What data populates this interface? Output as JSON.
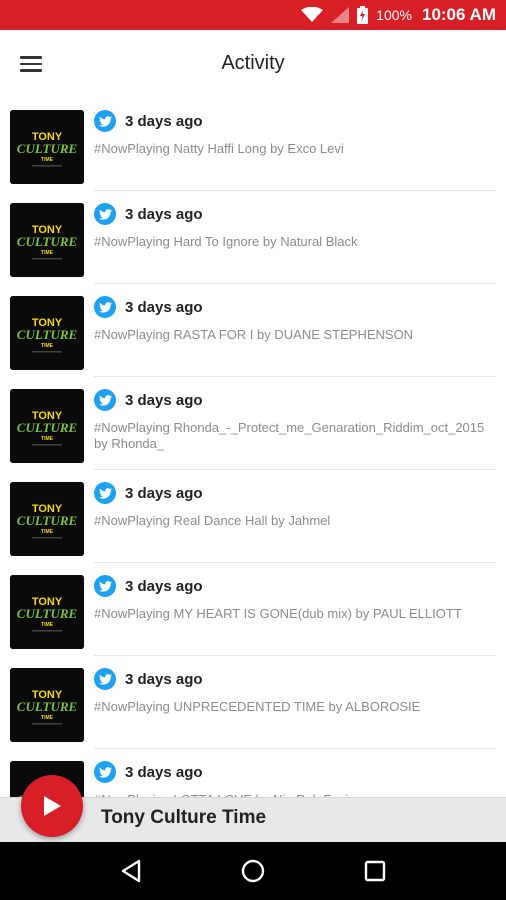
{
  "status_bar": {
    "wifi_icon": "wifi-icon",
    "signal_icon": "signal-icon",
    "battery_icon": "battery-charging-icon",
    "battery": "100%",
    "time": "10:06 AM"
  },
  "app_bar": {
    "menu_icon": "hamburger-menu-icon",
    "title": "Activity"
  },
  "feed": {
    "items": [
      {
        "time": "3 days ago",
        "text": "#NowPlaying Natty Haffi Long by Exco Levi"
      },
      {
        "time": "3 days ago",
        "text": "#NowPlaying Hard To Ignore by Natural Black"
      },
      {
        "time": "3 days ago",
        "text": "#NowPlaying RASTA FOR I by DUANE STEPHENSON"
      },
      {
        "time": "3 days ago",
        "text": "#NowPlaying Rhonda_-_Protect_me_Genaration_Riddim_oct_2015 by Rhonda_"
      },
      {
        "time": "3 days ago",
        "text": "#NowPlaying Real Dance Hall by Jahmel"
      },
      {
        "time": "3 days ago",
        "text": "#NowPlaying MY HEART IS GONE(dub mix) by PAUL ELLIOTT"
      },
      {
        "time": "3 days ago",
        "text": "#NowPlaying UNPRECEDENTED TIME by ALBOROSIE"
      },
      {
        "time": "3 days ago",
        "text": "#NowPlaying LOTTA LOVE by Nio Rob Faci"
      }
    ],
    "item_icon": "twitter-icon",
    "thumb_logo_lines": [
      "TONY",
      "CULTURE",
      "TIME"
    ]
  },
  "mini_player": {
    "title": "Tony Culture Time",
    "play_icon": "play-icon"
  },
  "nav_bar": {
    "back_icon": "back-triangle-icon",
    "home_icon": "home-circle-icon",
    "recents_icon": "recents-square-icon"
  },
  "colors": {
    "accent": "#d81f26",
    "twitter": "#1da1f2",
    "logo_green": "#7cc242",
    "logo_yellow": "#f5d90a"
  }
}
